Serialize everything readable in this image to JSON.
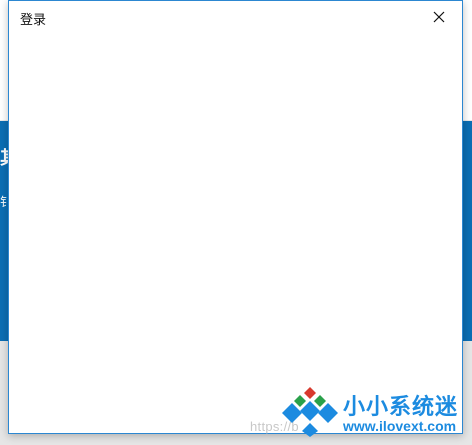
{
  "dialog": {
    "title": "登录",
    "close_icon": "close-icon"
  },
  "background": {
    "glyph_a": "其",
    "glyph_b": "钅"
  },
  "watermark": {
    "url_fragment": "https://b",
    "brand": "小小系统迷",
    "site": "www.ilovext.com",
    "colors": {
      "brand": "#1c8be0",
      "red": "#d83a2e",
      "green": "#2aa14a",
      "blue": "#1c8be0"
    }
  },
  "colors": {
    "bg_blue": "#0b6eb4",
    "dialog_border": "#2c87d1"
  }
}
